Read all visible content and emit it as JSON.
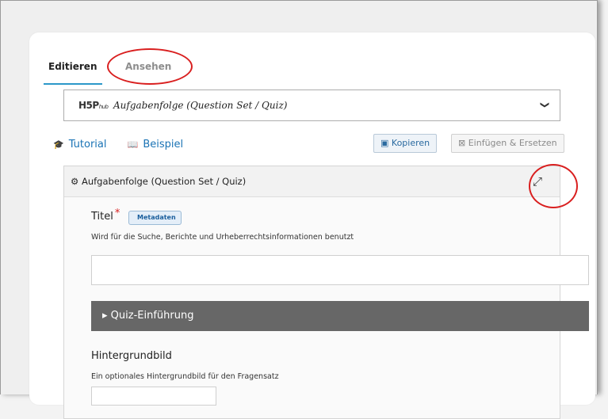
{
  "tabs": {
    "edit": "Editieren",
    "view": "Ansehen"
  },
  "content_type": {
    "logo": "H5P",
    "logo_sub": "hub",
    "title": "Aufgabenfolge (Question Set / Quiz)",
    "chevron": "❯"
  },
  "links": {
    "tutorial": "Tutorial",
    "example": "Beispiel"
  },
  "buttons": {
    "copy": "Kopieren",
    "paste": "Einfügen & Ersetzen"
  },
  "editor": {
    "panel_title": "Aufgabenfolge (Question Set / Quiz)",
    "title_label": "Titel",
    "required_mark": "*",
    "metadata_badge": "Metadaten",
    "title_description": "Wird für die Suche, Berichte und Urheberrechtsinformationen benutzt",
    "title_value": "",
    "intro_section": "Quiz-Einführung",
    "bg_label": "Hintergrundbild",
    "bg_description": "Ein optionales Hintergrundbild für den Fragensatz"
  },
  "colors": {
    "accent": "#2b98c9",
    "annotation": "#d91f1f",
    "section_bar": "#676767"
  },
  "icons": [
    "mortarboard-icon",
    "book-icon",
    "clipboard-icon",
    "clipboard-x-icon",
    "settings-icon",
    "expand-icon",
    "caret-right-icon",
    "chevron-down-icon"
  ]
}
